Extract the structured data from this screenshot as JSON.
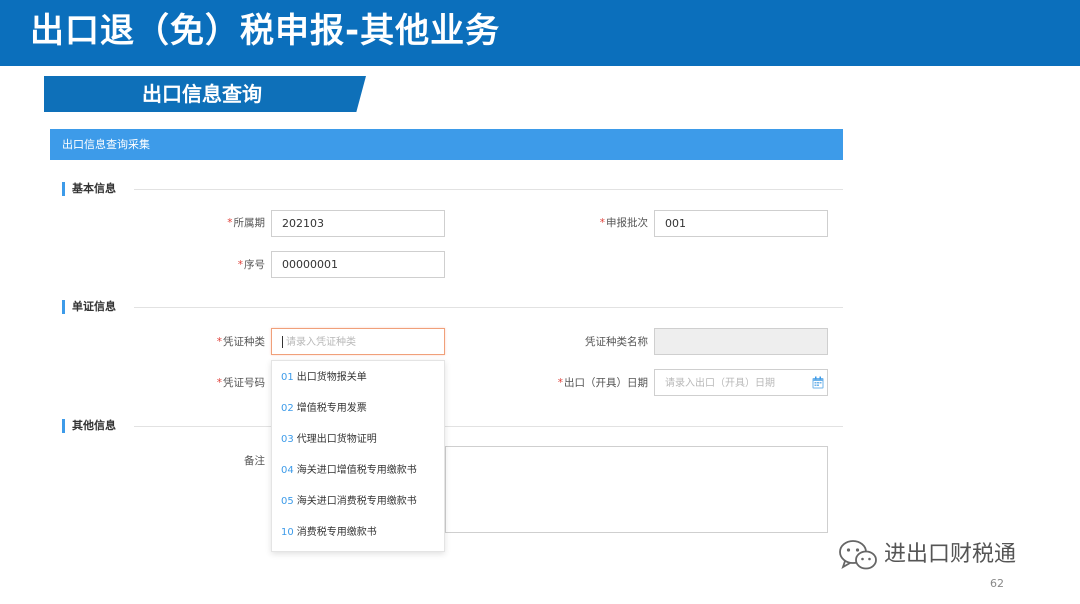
{
  "slide": {
    "title": "出口退（免）税申报-其他业务",
    "section_label": "出口信息查询",
    "page_number": "62"
  },
  "panel": {
    "header": "出口信息查询采集"
  },
  "groups": {
    "basic": "基本信息",
    "document": "单证信息",
    "other": "其他信息"
  },
  "fields": {
    "period": {
      "required": "*",
      "label": "所属期",
      "value": "202103"
    },
    "batch": {
      "required": "*",
      "label": "申报批次",
      "value": "001"
    },
    "serial": {
      "required": "*",
      "label": "序号",
      "value": "00000001"
    },
    "voucher_type": {
      "required": "*",
      "label": "凭证种类",
      "placeholder": "请录入凭证种类"
    },
    "voucher_type_name": {
      "label": "凭证种类名称",
      "value": ""
    },
    "voucher_number": {
      "required": "*",
      "label": "凭证号码"
    },
    "export_date": {
      "required": "*",
      "label": "出口（开具）日期",
      "placeholder": "请录入出口（开具）日期"
    },
    "remarks": {
      "label": "备注"
    }
  },
  "voucher_options": [
    {
      "code": "01",
      "label": "出口货物报关单"
    },
    {
      "code": "02",
      "label": "增值税专用发票"
    },
    {
      "code": "03",
      "label": "代理出口货物证明"
    },
    {
      "code": "04",
      "label": "海关进口增值税专用缴款书"
    },
    {
      "code": "05",
      "label": "海关进口消费税专用缴款书"
    },
    {
      "code": "10",
      "label": "消费税专用缴款书"
    }
  ],
  "watermark": {
    "text": "进出口财税通",
    "icon": "wechat-icon"
  },
  "colors": {
    "banner": "#0b6fbc",
    "panel_header": "#3d9be9",
    "required": "#e0413a",
    "focus_border": "#f0a07a"
  }
}
